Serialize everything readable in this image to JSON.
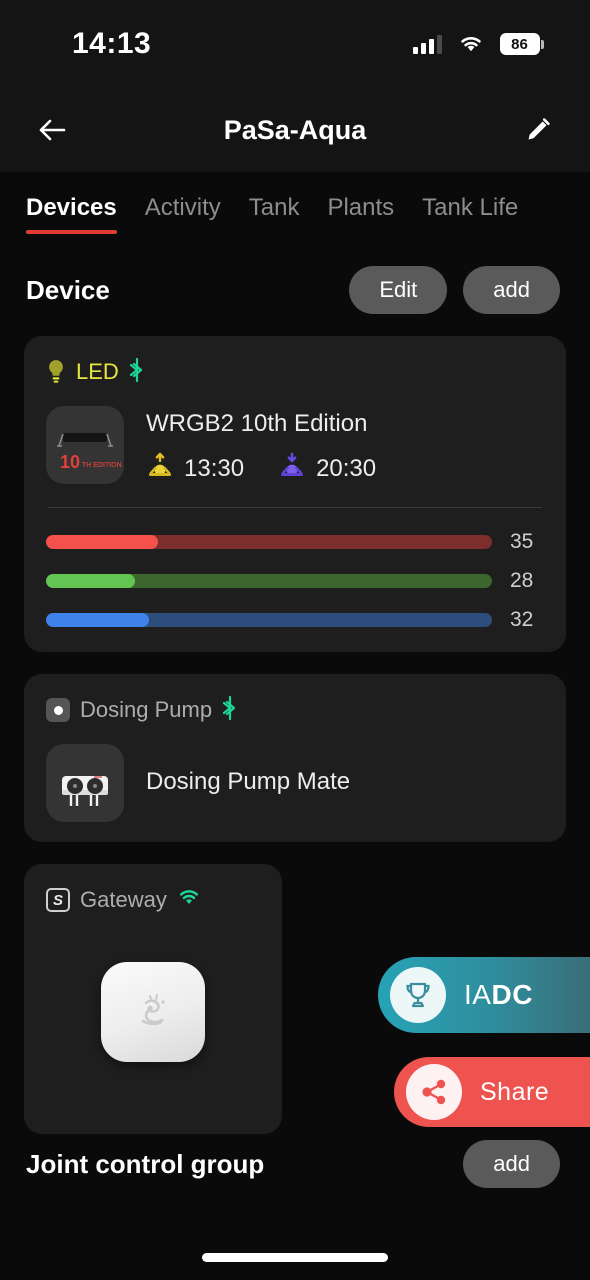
{
  "status_bar": {
    "time": "14:13",
    "battery_level": "86",
    "signal_icon": "cellular-signal-icon",
    "wifi_icon": "wifi-icon",
    "battery_icon": "battery-icon"
  },
  "nav": {
    "title": "PaSa-Aqua",
    "back_icon": "back-arrow-icon",
    "edit_icon": "pencil-edit-icon"
  },
  "tabs": [
    {
      "label": "Devices",
      "active": true
    },
    {
      "label": "Activity",
      "active": false
    },
    {
      "label": "Tank",
      "active": false
    },
    {
      "label": "Plants",
      "active": false
    },
    {
      "label": "Tank Life",
      "active": false
    }
  ],
  "device_section": {
    "title": "Device",
    "edit_label": "Edit",
    "add_label": "add"
  },
  "led_card": {
    "category": "LED",
    "category_icon": "light-bulb-icon",
    "connection_icon": "bluetooth-icon",
    "thumb_number": "10",
    "thumb_sub": "TH EDITION",
    "device_name": "WRGB2 10th Edition",
    "sunrise_icon": "sunrise-icon",
    "sunrise_time": "13:30",
    "sunset_icon": "sunset-icon",
    "sunset_time": "20:30",
    "channels": [
      {
        "name": "red",
        "value": "35",
        "percent": 25,
        "fill": "#f4514c",
        "track": "#7c2e2c"
      },
      {
        "name": "green",
        "value": "28",
        "percent": 20,
        "fill": "#63c653",
        "track": "#3d662f"
      },
      {
        "name": "blue",
        "value": "32",
        "percent": 23,
        "fill": "#3f82ea",
        "track": "#2d4e7c"
      }
    ]
  },
  "dosing_card": {
    "category": "Dosing Pump",
    "category_icon": "dosing-pump-chip-icon",
    "connection_icon": "bluetooth-icon",
    "device_name": "Dosing Pump Mate"
  },
  "gateway_card": {
    "category": "Gateway",
    "category_icon": "brand-logo-icon",
    "connection_icon": "wifi-icon",
    "device_icon": "gateway-device-image"
  },
  "floating_actions": [
    {
      "id": "iadc",
      "icon": "trophy-icon",
      "label_thin": "IA",
      "label_bold": "DC",
      "color": "#26a3b6"
    },
    {
      "id": "share",
      "icon": "share-nodes-icon",
      "label": "Share",
      "color": "#ef5350"
    }
  ],
  "joint_section": {
    "title": "Joint control group",
    "add_label": "add"
  },
  "theme": {
    "background": "#0a0a0a",
    "card_background": "#1e1e1e",
    "accent_red": "#e23b36",
    "bluetooth_teal": "#1fd49a",
    "led_yellow": "#e6e63f"
  }
}
